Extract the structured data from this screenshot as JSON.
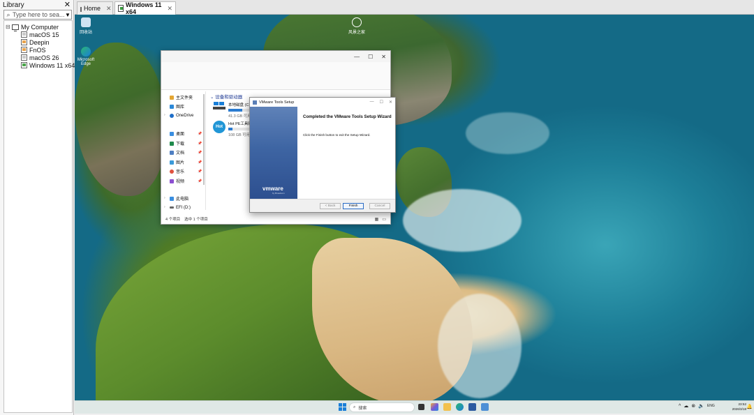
{
  "library": {
    "title": "Library",
    "close_glyph": "✕",
    "search_placeholder": "Type here to sea...",
    "root": "My Computer",
    "items": [
      {
        "label": "macOS 15",
        "state": "off"
      },
      {
        "label": "Deepin",
        "state": "warn"
      },
      {
        "label": "FnOS",
        "state": "warn"
      },
      {
        "label": "macOS 26",
        "state": "off"
      },
      {
        "label": "Windows 11 x64",
        "state": "running"
      }
    ]
  },
  "tabs": [
    {
      "label": "Home",
      "icon": "home-icon"
    },
    {
      "label": "Windows 11 x64",
      "icon": "vm-icon",
      "active": true
    }
  ],
  "desktop": {
    "icons": [
      {
        "label": "回收站",
        "icon": "recycle-bin-icon"
      },
      {
        "label": "Microsoft Edge",
        "icon": "edge-icon"
      },
      {
        "label": "风景之家",
        "icon": "wallpaper-icon"
      }
    ]
  },
  "explorer": {
    "controls": [
      "—",
      "☐",
      "✕"
    ],
    "nav": [
      {
        "label": "主文件夹",
        "icon": "home-folder-icon",
        "color": "#e3a634"
      },
      {
        "label": "图库",
        "icon": "gallery-icon",
        "color": "#2b88d8"
      },
      {
        "label": "OneDrive",
        "icon": "cloud-icon",
        "color": "#1e6ec8"
      },
      {
        "label": "桌面",
        "icon": "desktop-icon",
        "color": "#3a8ee0"
      },
      {
        "label": "下载",
        "icon": "download-icon",
        "color": "#1f8a4c"
      },
      {
        "label": "文档",
        "icon": "document-icon",
        "color": "#4f7fc2"
      },
      {
        "label": "图片",
        "icon": "picture-icon",
        "color": "#3b9ad9"
      },
      {
        "label": "音乐",
        "icon": "music-icon",
        "color": "#e0523f"
      },
      {
        "label": "视频",
        "icon": "video-icon",
        "color": "#8c4fd1"
      },
      {
        "label": "此电脑",
        "icon": "this-pc-icon",
        "color": "#3a8ee0"
      },
      {
        "label": "EFI (D:)",
        "icon": "drive-icon",
        "color": "#666666"
      }
    ],
    "section": "设备和驱动器",
    "drives": [
      {
        "name": "本地磁盘 (C:)",
        "free": "41.3 GB 可用",
        "used_fraction": 0.65
      },
      {
        "name": "Hot PE工具箱",
        "free": "108 GB 可用",
        "used_fraction": 0.2
      }
    ],
    "status_count": "4 个项目",
    "status_selected": "选中 1 个项目"
  },
  "setup": {
    "title": "VMware Tools Setup",
    "heading": "Completed the VMware Tools Setup Wizard",
    "text": "Click the Finish button to exit the Setup Wizard.",
    "brand": "vmware",
    "brand_sub": "by Broadcom",
    "back_label": "< Back",
    "finish_label": "Finish",
    "cancel_label": "Cancel"
  },
  "taskbar": {
    "search_label": "搜索",
    "apps": [
      "task-view-icon",
      "copilot-icon",
      "file-explorer-icon",
      "edge-icon",
      "store-icon",
      "vmware-tools-icon"
    ],
    "tray": [
      "^",
      "☁",
      "⊗",
      "🔈",
      "ENG"
    ],
    "time": "23:52",
    "date": "2026/3/18"
  }
}
